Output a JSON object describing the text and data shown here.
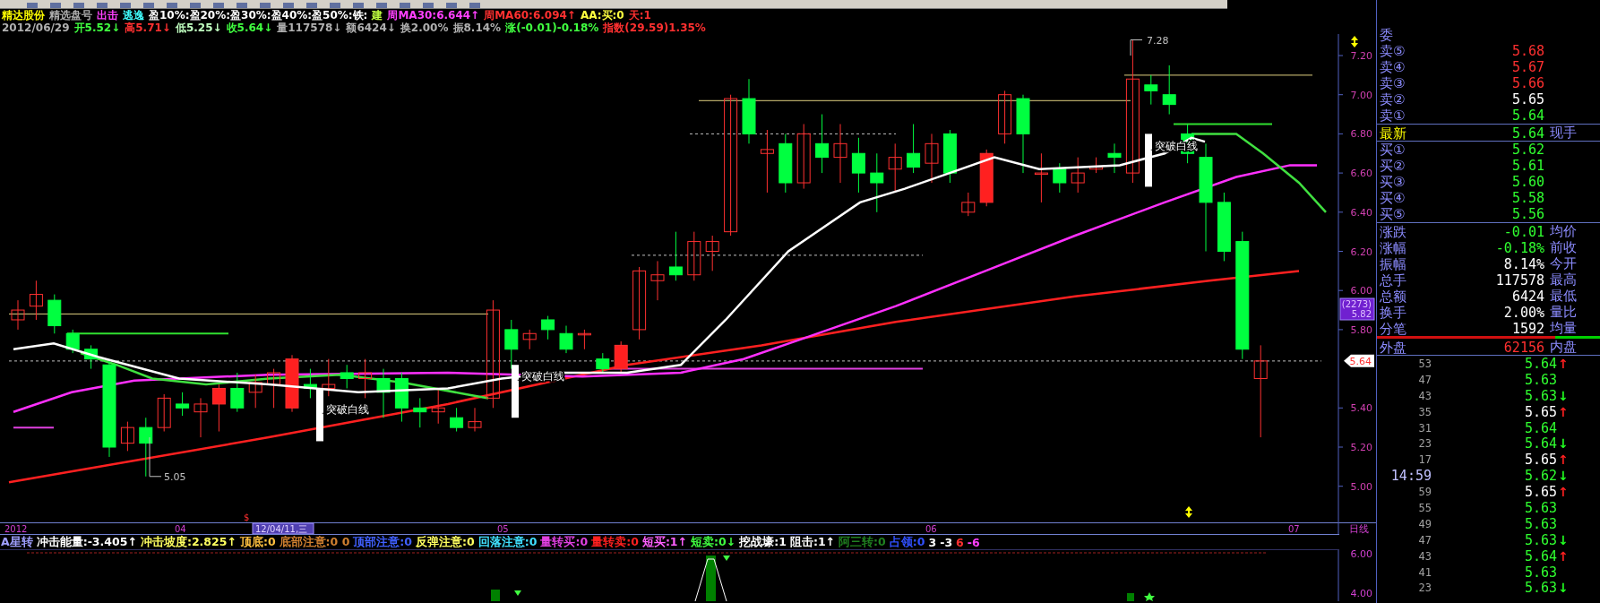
{
  "header": {
    "title_segments": [
      {
        "text": "精达股份",
        "color": "#ffff00"
      },
      {
        "text": "精选盘号",
        "color": "#b0b0b0"
      },
      {
        "text": "出击",
        "color": "#ff40ff"
      },
      {
        "text": "逃逸",
        "color": "#40ffff"
      },
      {
        "text": "盈10%:盈20%:盈30%:盈40%:盈50%:铁:",
        "color": "#ffffff"
      },
      {
        "text": "建",
        "color": "#c0ff40"
      },
      {
        "text": "周MA30:6.644↑",
        "color": "#ff40ff"
      },
      {
        "text": "周MA60:6.094↑",
        "color": "#ff3030"
      },
      {
        "text": "AA:买:0",
        "color": "#ffff40"
      },
      {
        "text": "天:1",
        "color": "#ff3030"
      }
    ],
    "quote_segments": [
      {
        "text": "2012/06/29",
        "color": "#b0b0b0"
      },
      {
        "text": "开5.52↓",
        "color": "#40ff40"
      },
      {
        "text": "高5.71↓",
        "color": "#ff3030"
      },
      {
        "text": "低5.25↓",
        "color": "#c0ffc0"
      },
      {
        "text": "收5.64↓",
        "color": "#40ff40"
      },
      {
        "text": "量117578↓",
        "color": "#b0b0b0"
      },
      {
        "text": "额6424↓",
        "color": "#b0b0b0"
      },
      {
        "text": "换2.00%",
        "color": "#b0b0b0"
      },
      {
        "text": "振8.14%",
        "color": "#b0b0b0"
      },
      {
        "text": "涨(-0.01)-0.18%",
        "color": "#40ff40"
      },
      {
        "text": "指数(29.59)1.35%",
        "color": "#ff3030"
      }
    ]
  },
  "chart": {
    "y_labels": [
      "7.20",
      "7.00",
      "6.80",
      "6.60",
      "6.40",
      "6.20",
      "6.00",
      "5.80",
      "5.40",
      "5.20",
      "5.00"
    ],
    "high_annotation": "7.28",
    "low_annotation": "5.05",
    "signals": [
      "突破白线",
      "突破白线",
      "突破白线"
    ],
    "cursor_tag": {
      "count": "(2273)",
      "price": "5.82"
    },
    "last_price_tag": "5.64",
    "marker": "$"
  },
  "date_axis": {
    "labels": [
      "2012",
      "04",
      "05",
      "06",
      "07"
    ],
    "cursor_date": "12/04/11,三",
    "period": "日线"
  },
  "indicator_bar": {
    "name": "A星转",
    "items": [
      {
        "text": "冲击能量:-3.405↑",
        "color": "#ffffff"
      },
      {
        "text": "冲击坡度:2.825↑",
        "color": "#ffff60"
      },
      {
        "text": "顶底:0",
        "color": "#ffc040"
      },
      {
        "text": "底部注意:0 0",
        "color": "#d08030"
      },
      {
        "text": "顶部注意:0",
        "color": "#4060ff"
      },
      {
        "text": "反弹注意:0",
        "color": "#ffff60"
      },
      {
        "text": "回落注意:0",
        "color": "#40e0ff"
      },
      {
        "text": "量转买:0",
        "color": "#e040e0"
      },
      {
        "text": "量转卖:0",
        "color": "#ff2020"
      },
      {
        "text": "短买:1↑",
        "color": "#ff60ff"
      },
      {
        "text": "短卖:0↓",
        "color": "#40ff40"
      },
      {
        "text": "挖战壕:1",
        "color": "#ffffff"
      },
      {
        "text": "阻击:1↑",
        "color": "#ffffff"
      },
      {
        "text": "阿三转:0",
        "color": "#208020"
      },
      {
        "text": "占领:0",
        "color": "#3050ff"
      },
      {
        "text": "3",
        "color": "#ffffff"
      },
      {
        "text": "-3",
        "color": "#ffffff"
      },
      {
        "text": "6",
        "color": "#ff3030"
      },
      {
        "text": "-6",
        "color": "#ff40ff"
      }
    ]
  },
  "lower_panel": {
    "y_labels": [
      "6.00",
      "4.00"
    ]
  },
  "quote_panel": {
    "title": "委",
    "order_book": [
      {
        "kind": "ask",
        "label": "卖⑤",
        "price": "5.68",
        "color": "#ff3030"
      },
      {
        "kind": "ask",
        "label": "卖④",
        "price": "5.67",
        "color": "#ff3030"
      },
      {
        "kind": "ask",
        "label": "卖③",
        "price": "5.66",
        "color": "#ff3030"
      },
      {
        "kind": "ask",
        "label": "卖②",
        "price": "5.65",
        "color": "#ffffff"
      },
      {
        "kind": "ask",
        "label": "卖①",
        "price": "5.64",
        "color": "#30ff30"
      },
      {
        "kind": "last",
        "label": "最新",
        "price": "5.64",
        "color": "#30ff30",
        "extra": "现手"
      },
      {
        "kind": "bid",
        "label": "买①",
        "price": "5.62",
        "color": "#30ff30"
      },
      {
        "kind": "bid",
        "label": "买②",
        "price": "5.61",
        "color": "#30ff30"
      },
      {
        "kind": "bid",
        "label": "买③",
        "price": "5.60",
        "color": "#30ff30"
      },
      {
        "kind": "bid",
        "label": "买④",
        "price": "5.58",
        "color": "#30ff30"
      },
      {
        "kind": "bid",
        "label": "买⑤",
        "price": "5.56",
        "color": "#30ff30"
      }
    ],
    "stats": [
      {
        "label": "涨跌",
        "value": "-0.01",
        "color": "#30ff30",
        "extra": "均价"
      },
      {
        "label": "涨幅",
        "value": "-0.18%",
        "color": "#30ff30",
        "extra": "前收"
      },
      {
        "label": "振幅",
        "value": "8.14%",
        "color": "#ffffff",
        "extra": "今开"
      },
      {
        "label": "总手",
        "value": "117578",
        "color": "#ffffff",
        "extra": "最高"
      },
      {
        "label": "总额",
        "value": "6424",
        "color": "#ffffff",
        "extra": "最低"
      },
      {
        "label": "换手",
        "value": "2.00%",
        "color": "#ffffff",
        "extra": "量比"
      },
      {
        "label": "分笔",
        "value": "1592",
        "color": "#ffffff",
        "extra": "均量"
      }
    ],
    "outer_inner_bar": {
      "level": 0.8
    },
    "outer_volume": {
      "label": "外盘",
      "value": "62156",
      "color": "#ff3030",
      "extra": "内盘"
    },
    "ticks": [
      {
        "time": "53",
        "price": "5.64",
        "color": "#30ff30",
        "arrow": "↑"
      },
      {
        "time": "47",
        "price": "5.63",
        "color": "#30ff30"
      },
      {
        "time": "43",
        "price": "5.63",
        "color": "#30ff30",
        "arrow": "↓"
      },
      {
        "time": "35",
        "price": "5.65",
        "color": "#ffffff",
        "arrow": "↑"
      },
      {
        "time": "31",
        "price": "5.64",
        "color": "#30ff30"
      },
      {
        "time": "23",
        "price": "5.64",
        "color": "#30ff30",
        "arrow": "↓"
      },
      {
        "time": "17",
        "price": "5.65",
        "color": "#ffffff",
        "arrow": "↑"
      },
      {
        "time": "14:59",
        "price": "5.62",
        "color": "#30ff30",
        "arrow": "↓"
      },
      {
        "time": "59",
        "price": "5.65",
        "color": "#ffffff",
        "arrow": "↑"
      },
      {
        "time": "55",
        "price": "5.63",
        "color": "#30ff30"
      },
      {
        "time": "49",
        "price": "5.63",
        "color": "#30ff30"
      },
      {
        "time": "47",
        "price": "5.63",
        "color": "#30ff30",
        "arrow": "↓"
      },
      {
        "time": "43",
        "price": "5.64",
        "color": "#30ff30",
        "arrow": "↑"
      },
      {
        "time": "41",
        "price": "5.63",
        "color": "#30ff30"
      },
      {
        "time": "23",
        "price": "5.63",
        "color": "#30ff30",
        "arrow": "↓"
      }
    ]
  }
}
